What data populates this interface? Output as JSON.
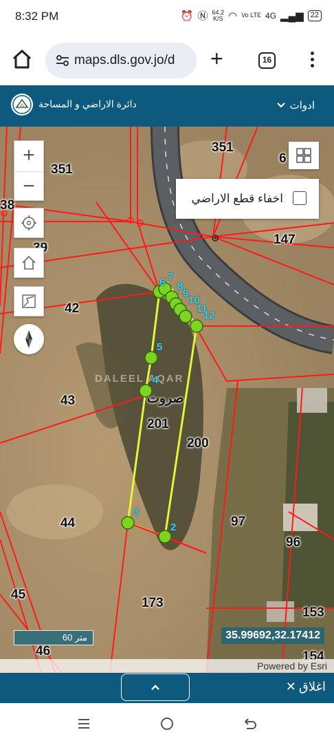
{
  "status": {
    "time": "8:32 PM",
    "net_speed": "64.2",
    "net_unit": "K/S",
    "volte": "Vo LTE",
    "signal": "4G",
    "battery": "22"
  },
  "browser": {
    "url": "maps.dls.gov.jo/d",
    "tab_count": "16"
  },
  "site": {
    "org_name": "دائرة الاراضي و المساحة",
    "tools_label": "ادوات"
  },
  "map": {
    "hide_parcels_label": "اخفاء قطع الاراضي",
    "hide_parcels_checked": false,
    "parcel_numbers": [
      "351",
      "351",
      "6",
      "38",
      "39",
      "147",
      "42",
      "43",
      "201",
      "200",
      "97",
      "44",
      "96",
      "45",
      "173",
      "153",
      "46",
      "154"
    ],
    "vertex_labels": [
      "6",
      "7",
      "8",
      "9",
      "10",
      "11",
      "12",
      "5",
      "4",
      "3",
      "2"
    ],
    "place_name": "صروت",
    "watermark": "DALEEL AQAR",
    "scale_label": "60 متر",
    "coordinates": "35.99692,32.17412",
    "attribution": "Powered by Esri"
  },
  "bottom": {
    "close_label": "اغلاق"
  },
  "colors": {
    "header": "#0e5a7e",
    "parcel_lines": "#ff1a1a",
    "selected_parcel": "#e4f53a",
    "vertex_fill": "#7ed321",
    "vertex_label": "#35d1e8"
  }
}
